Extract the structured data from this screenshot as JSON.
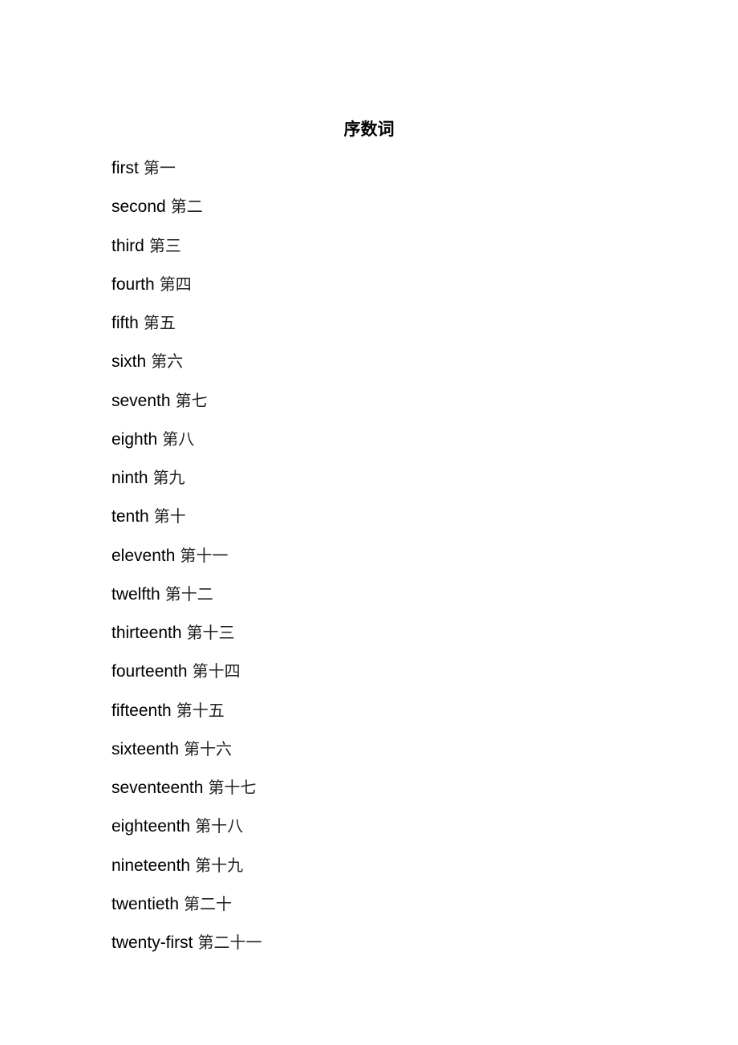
{
  "document": {
    "title": "序数词",
    "entries": [
      {
        "english": "first",
        "chinese": "第一"
      },
      {
        "english": "second",
        "chinese": "第二"
      },
      {
        "english": "third",
        "chinese": "第三"
      },
      {
        "english": "fourth",
        "chinese": "第四"
      },
      {
        "english": "fifth",
        "chinese": "第五"
      },
      {
        "english": "sixth",
        "chinese": "第六"
      },
      {
        "english": "seventh",
        "chinese": "第七"
      },
      {
        "english": "eighth",
        "chinese": "第八"
      },
      {
        "english": "ninth",
        "chinese": "第九"
      },
      {
        "english": "tenth",
        "chinese": "第十"
      },
      {
        "english": "eleventh",
        "chinese": "第十一"
      },
      {
        "english": "twelfth",
        "chinese": "第十二"
      },
      {
        "english": "thirteenth",
        "chinese": "第十三"
      },
      {
        "english": "fourteenth",
        "chinese": "第十四"
      },
      {
        "english": "fifteenth",
        "chinese": "第十五"
      },
      {
        "english": "sixteenth",
        "chinese": "第十六"
      },
      {
        "english": "seventeenth",
        "chinese": "第十七"
      },
      {
        "english": "eighteenth",
        "chinese": "第十八"
      },
      {
        "english": "nineteenth",
        "chinese": "第十九"
      },
      {
        "english": "twentieth",
        "chinese": "第二十"
      },
      {
        "english": "twenty-first",
        "chinese": "第二十一"
      }
    ]
  }
}
